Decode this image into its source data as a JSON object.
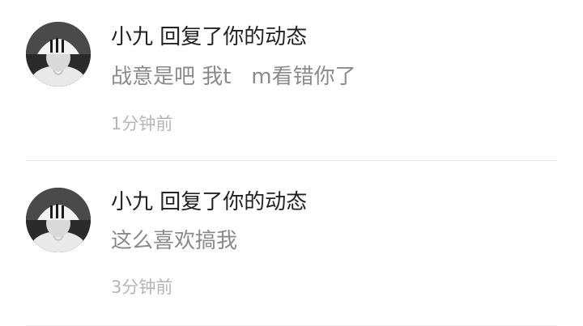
{
  "notifications": [
    {
      "user": "小九",
      "action": "回复了你的动态",
      "title": "小九 回复了你的动态",
      "message": "战意是吧 我t   m看错你了",
      "time": "1分钟前",
      "avatar_icon": "user-avatar-icon"
    },
    {
      "user": "小九",
      "action": "回复了你的动态",
      "title": "小九 回复了你的动态",
      "message": "这么喜欢搞我",
      "time": "3分钟前",
      "avatar_icon": "user-avatar-icon"
    }
  ],
  "colors": {
    "title": "#222222",
    "message": "#8a8a8a",
    "time": "#b5b5b5",
    "divider": "#ebebeb"
  }
}
